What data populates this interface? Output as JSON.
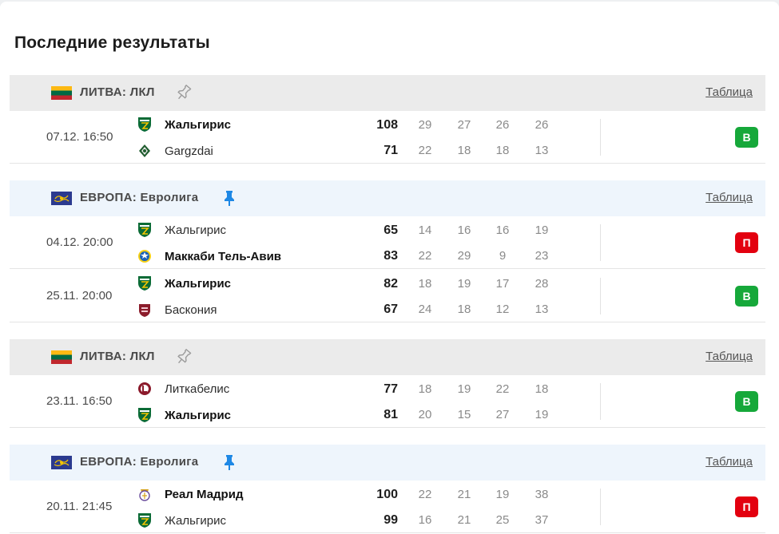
{
  "title": "Последние результаты",
  "table_link_label": "Таблица",
  "leagues": [
    {
      "name": "ЛИТВА: ЛКЛ",
      "flag": "lithuania-flag",
      "pinned": false,
      "style": "gray",
      "matches": [
        {
          "date": "07.12. 16:50",
          "home": {
            "name": "Жальгирис",
            "score": "108",
            "quarters": [
              "29",
              "27",
              "26",
              "26"
            ],
            "winner": true,
            "logo": "zalgiris"
          },
          "away": {
            "name": "Gargzdai",
            "score": "71",
            "quarters": [
              "22",
              "18",
              "18",
              "13"
            ],
            "winner": false,
            "logo": "gargzdai"
          },
          "result": "В",
          "result_type": "win"
        }
      ]
    },
    {
      "name": "ЕВРОПА: Евролига",
      "flag": "europe-flag",
      "pinned": true,
      "style": "blue",
      "matches": [
        {
          "date": "04.12. 20:00",
          "home": {
            "name": "Жальгирис",
            "score": "65",
            "quarters": [
              "14",
              "16",
              "16",
              "19"
            ],
            "winner": false,
            "logo": "zalgiris"
          },
          "away": {
            "name": "Маккаби Тель-Авив",
            "score": "83",
            "quarters": [
              "22",
              "29",
              "9",
              "23"
            ],
            "winner": true,
            "logo": "maccabi"
          },
          "result": "П",
          "result_type": "loss"
        },
        {
          "date": "25.11. 20:00",
          "home": {
            "name": "Жальгирис",
            "score": "82",
            "quarters": [
              "18",
              "19",
              "17",
              "28"
            ],
            "winner": true,
            "logo": "zalgiris"
          },
          "away": {
            "name": "Баскония",
            "score": "67",
            "quarters": [
              "24",
              "18",
              "12",
              "13"
            ],
            "winner": false,
            "logo": "baskonia"
          },
          "result": "В",
          "result_type": "win"
        }
      ]
    },
    {
      "name": "ЛИТВА: ЛКЛ",
      "flag": "lithuania-flag",
      "pinned": false,
      "style": "gray",
      "matches": [
        {
          "date": "23.11. 16:50",
          "home": {
            "name": "Литкабелис",
            "score": "77",
            "quarters": [
              "18",
              "19",
              "22",
              "18"
            ],
            "winner": false,
            "logo": "litkabelis"
          },
          "away": {
            "name": "Жальгирис",
            "score": "81",
            "quarters": [
              "20",
              "15",
              "27",
              "19"
            ],
            "winner": true,
            "logo": "zalgiris"
          },
          "result": "В",
          "result_type": "win"
        }
      ]
    },
    {
      "name": "ЕВРОПА: Евролига",
      "flag": "europe-flag",
      "pinned": true,
      "style": "blue",
      "matches": [
        {
          "date": "20.11. 21:45",
          "home": {
            "name": "Реал Мадрид",
            "score": "100",
            "quarters": [
              "22",
              "21",
              "19",
              "38"
            ],
            "winner": true,
            "logo": "real-madrid"
          },
          "away": {
            "name": "Жальгирис",
            "score": "99",
            "quarters": [
              "16",
              "21",
              "25",
              "37"
            ],
            "winner": false,
            "logo": "zalgiris"
          },
          "result": "П",
          "result_type": "loss"
        }
      ]
    }
  ],
  "colors": {
    "win": "#16a83a",
    "loss": "#e3000f",
    "pin_active": "#1e88e5",
    "pin_inactive": "#9a9a9a"
  }
}
